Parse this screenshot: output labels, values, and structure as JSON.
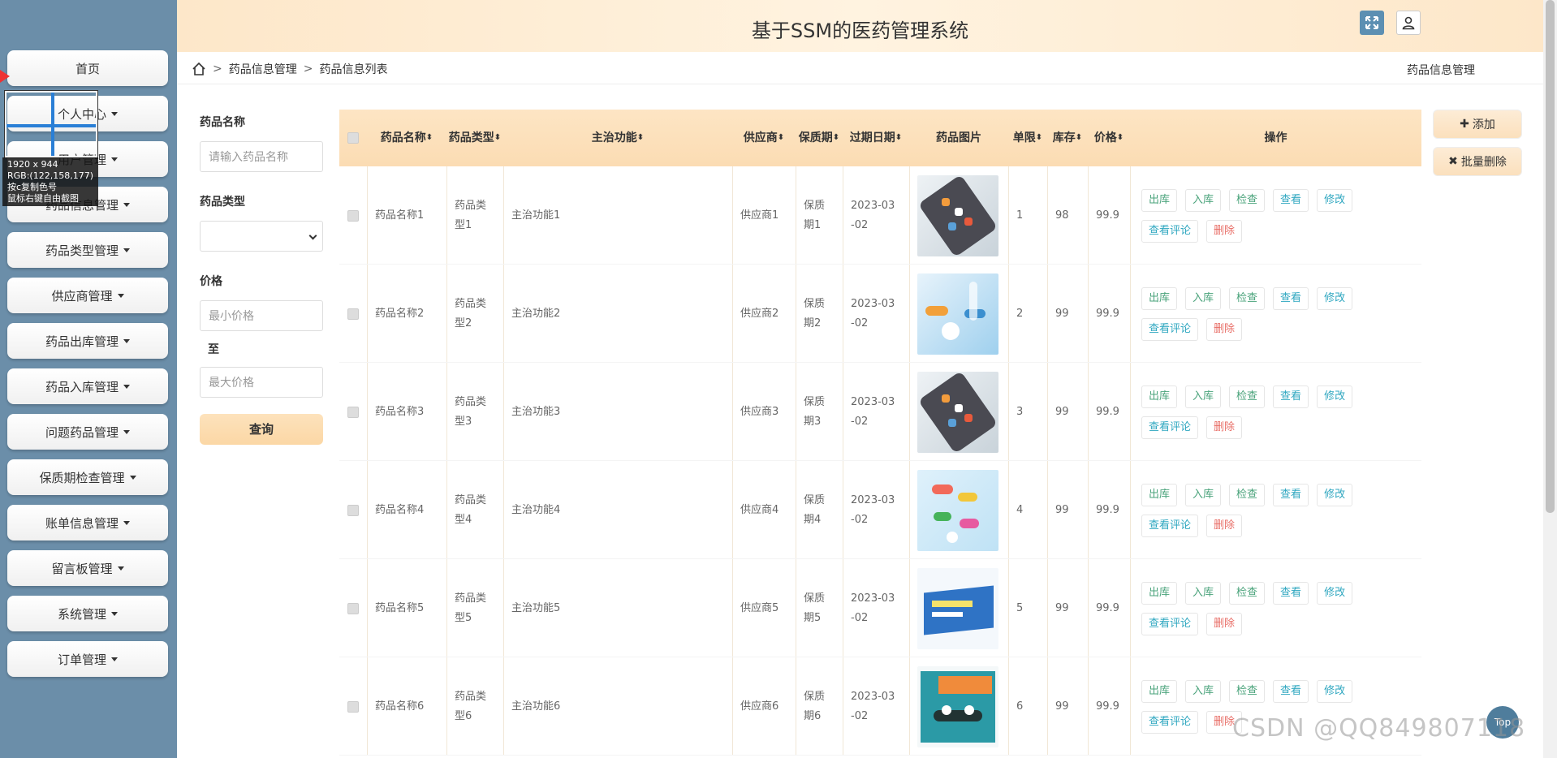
{
  "header": {
    "title": "基于SSM的医药管理系统"
  },
  "sidebar": {
    "items": [
      {
        "label": "首页",
        "caret": false
      },
      {
        "label": "个人中心",
        "caret": true
      },
      {
        "label": "用户管理",
        "caret": true
      },
      {
        "label": "药品信息管理",
        "caret": true
      },
      {
        "label": "药品类型管理",
        "caret": true
      },
      {
        "label": "供应商管理",
        "caret": true
      },
      {
        "label": "药品出库管理",
        "caret": true
      },
      {
        "label": "药品入库管理",
        "caret": true
      },
      {
        "label": "问题药品管理",
        "caret": true
      },
      {
        "label": "保质期检查管理",
        "caret": true
      },
      {
        "label": "账单信息管理",
        "caret": true
      },
      {
        "label": "留言板管理",
        "caret": true
      },
      {
        "label": "系统管理",
        "caret": true
      },
      {
        "label": "订单管理",
        "caret": true
      }
    ]
  },
  "overlay": {
    "size": "1920 x 944",
    "rgb": "RGB:(122,158,177)",
    "line3": "按c复制色号",
    "line4": "鼠标右键自由截图"
  },
  "breadcrumb": {
    "items": [
      "药品信息管理",
      "药品信息列表"
    ],
    "right": "药品信息管理"
  },
  "search": {
    "name_label": "药品名称",
    "name_placeholder": "请输入药品名称",
    "type_label": "药品类型",
    "type_value": "",
    "price_label": "价格",
    "min_placeholder": "最小价格",
    "to_label": "至",
    "max_placeholder": "最大价格",
    "button": "查询"
  },
  "actions": {
    "add": "添加",
    "batch_delete": "批量删除"
  },
  "table": {
    "headers": [
      "药品名称",
      "药品类型",
      "主治功能",
      "供应商",
      "保质期",
      "过期日期",
      "药品图片",
      "单限",
      "库存",
      "价格",
      "操作"
    ],
    "ops": [
      "出库",
      "入库",
      "检查",
      "查看",
      "修改",
      "查看评论",
      "删除"
    ],
    "rows": [
      {
        "name": "药品名称1",
        "type": "药品类型1",
        "func": "主治功能1",
        "supplier": "供应商1",
        "shelf": "保质期1",
        "expire": "2023-03-02",
        "limit": "1",
        "stock": "98",
        "price": "99.9",
        "img": "pillbox"
      },
      {
        "name": "药品名称2",
        "type": "药品类型2",
        "func": "主治功能2",
        "supplier": "供应商2",
        "shelf": "保质期2",
        "expire": "2023-03-02",
        "limit": "2",
        "stock": "99",
        "price": "99.9",
        "img": "capsules"
      },
      {
        "name": "药品名称3",
        "type": "药品类型3",
        "func": "主治功能3",
        "supplier": "供应商3",
        "shelf": "保质期3",
        "expire": "2023-03-02",
        "limit": "3",
        "stock": "99",
        "price": "99.9",
        "img": "pillbox"
      },
      {
        "name": "药品名称4",
        "type": "药品类型4",
        "func": "主治功能4",
        "supplier": "供应商4",
        "shelf": "保质期4",
        "expire": "2023-03-02",
        "limit": "4",
        "stock": "99",
        "price": "99.9",
        "img": "colorful-pills"
      },
      {
        "name": "药品名称5",
        "type": "药品类型5",
        "func": "主治功能5",
        "supplier": "供应商5",
        "shelf": "保质期5",
        "expire": "2023-03-02",
        "limit": "5",
        "stock": "99",
        "price": "99.9",
        "img": "medicine-box"
      },
      {
        "name": "药品名称6",
        "type": "药品类型6",
        "func": "主治功能6",
        "supplier": "供应商6",
        "shelf": "保质期6",
        "expire": "2023-03-02",
        "limit": "6",
        "stock": "99",
        "price": "99.9",
        "img": "keke-capsule"
      }
    ]
  },
  "totop": "Top",
  "watermark": "CSDN @QQ849807118"
}
